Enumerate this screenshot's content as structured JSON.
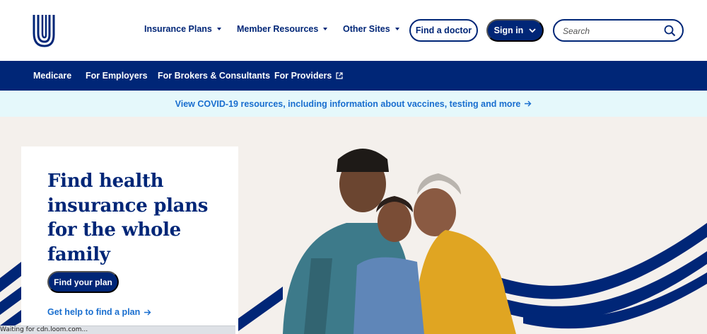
{
  "header": {
    "logo": "uhc-logo-icon",
    "nav": [
      {
        "label": "Insurance Plans"
      },
      {
        "label": "Member Resources"
      },
      {
        "label": "Other Sites"
      }
    ],
    "find_doctor_label": "Find a doctor",
    "signin_label": "Sign in",
    "search": {
      "placeholder": "Search",
      "value": ""
    }
  },
  "audience_nav": {
    "items": [
      {
        "label": "Medicare"
      },
      {
        "label": "For Employers"
      },
      {
        "label": "For Brokers & Consultants"
      },
      {
        "label": "For Providers"
      }
    ]
  },
  "banner": {
    "text": "View COVID-19 resources, including information about vaccines, testing and more"
  },
  "hero": {
    "title": "Find health insurance plans for the whole family",
    "cta_label": "Find your plan",
    "help_link": "Get help to find a plan",
    "image": "family-hug-photo"
  },
  "status": {
    "text": "Waiting for cdn.loom.com..."
  },
  "colors": {
    "brand_navy": "#002677",
    "link_blue": "#196ecf",
    "banner_bg": "#e5f8fb",
    "hero_bg": "#f4f0ec"
  }
}
